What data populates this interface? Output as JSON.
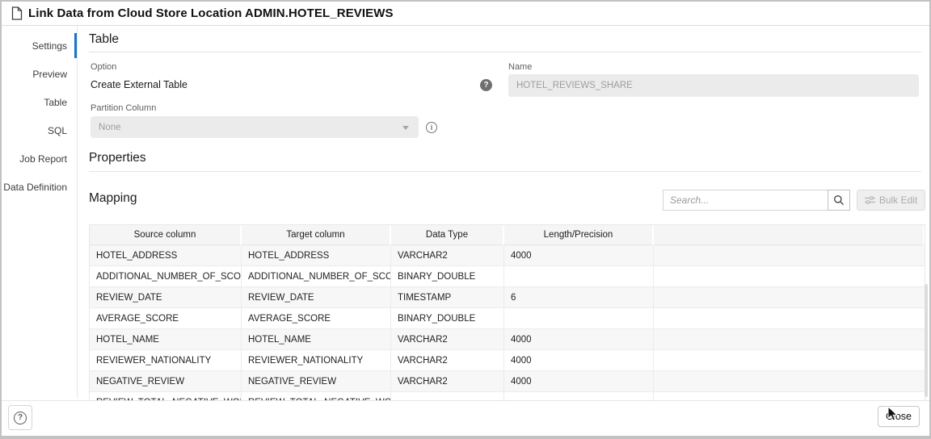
{
  "dialog": {
    "title": "Link Data from Cloud Store Location ADMIN.HOTEL_REVIEWS"
  },
  "sidebar": {
    "items": [
      {
        "label": "Settings",
        "active": true
      },
      {
        "label": "Preview",
        "active": false
      },
      {
        "label": "Table",
        "active": false
      },
      {
        "label": "SQL",
        "active": false
      },
      {
        "label": "Job Report",
        "active": false
      },
      {
        "label": "Data Definition",
        "active": false
      }
    ]
  },
  "table_section": {
    "heading": "Table",
    "option_label": "Option",
    "option_value": "Create External Table",
    "help_icon": "question-circle-filled",
    "name_label": "Name",
    "name_value": "HOTEL_REVIEWS_SHARE",
    "partition_label": "Partition Column",
    "partition_value": "None",
    "info_icon": "info-circle-outline"
  },
  "properties_section": {
    "heading": "Properties"
  },
  "mapping_section": {
    "heading": "Mapping",
    "search_placeholder": "Search...",
    "search_icon": "magnifier-icon",
    "bulk_edit_label": "Bulk Edit",
    "bulk_edit_icon": "sliders-icon",
    "columns": [
      "Source column",
      "Target column",
      "Data Type",
      "Length/Precision"
    ],
    "rows": [
      {
        "source": "HOTEL_ADDRESS",
        "target": "HOTEL_ADDRESS",
        "data_type": "VARCHAR2",
        "length": "4000"
      },
      {
        "source": "ADDITIONAL_NUMBER_OF_SCORI",
        "target": "ADDITIONAL_NUMBER_OF_SCOI",
        "data_type": "BINARY_DOUBLE",
        "length": ""
      },
      {
        "source": "REVIEW_DATE",
        "target": "REVIEW_DATE",
        "data_type": "TIMESTAMP",
        "length": "6"
      },
      {
        "source": "AVERAGE_SCORE",
        "target": "AVERAGE_SCORE",
        "data_type": "BINARY_DOUBLE",
        "length": ""
      },
      {
        "source": "HOTEL_NAME",
        "target": "HOTEL_NAME",
        "data_type": "VARCHAR2",
        "length": "4000"
      },
      {
        "source": "REVIEWER_NATIONALITY",
        "target": "REVIEWER_NATIONALITY",
        "data_type": "VARCHAR2",
        "length": "4000"
      },
      {
        "source": "NEGATIVE_REVIEW",
        "target": "NEGATIVE_REVIEW",
        "data_type": "VARCHAR2",
        "length": "4000"
      },
      {
        "source": "REVIEW_TOTAL_NEGATIVE_WOR",
        "target": "REVIEW_TOTAL_NEGATIVE_WOR",
        "data_type": "",
        "length": "",
        "partial": true
      }
    ]
  },
  "footer": {
    "help_icon": "question-circle-outline",
    "close_label": "Close"
  },
  "colors": {
    "accent_blue": "#1b74c5",
    "disabled_bg": "#ebebeb",
    "disabled_text": "#9e9e9e",
    "row_stripe": "#f7f7f7",
    "header_bg": "#f5f5f5",
    "border": "#d9d9d9"
  }
}
